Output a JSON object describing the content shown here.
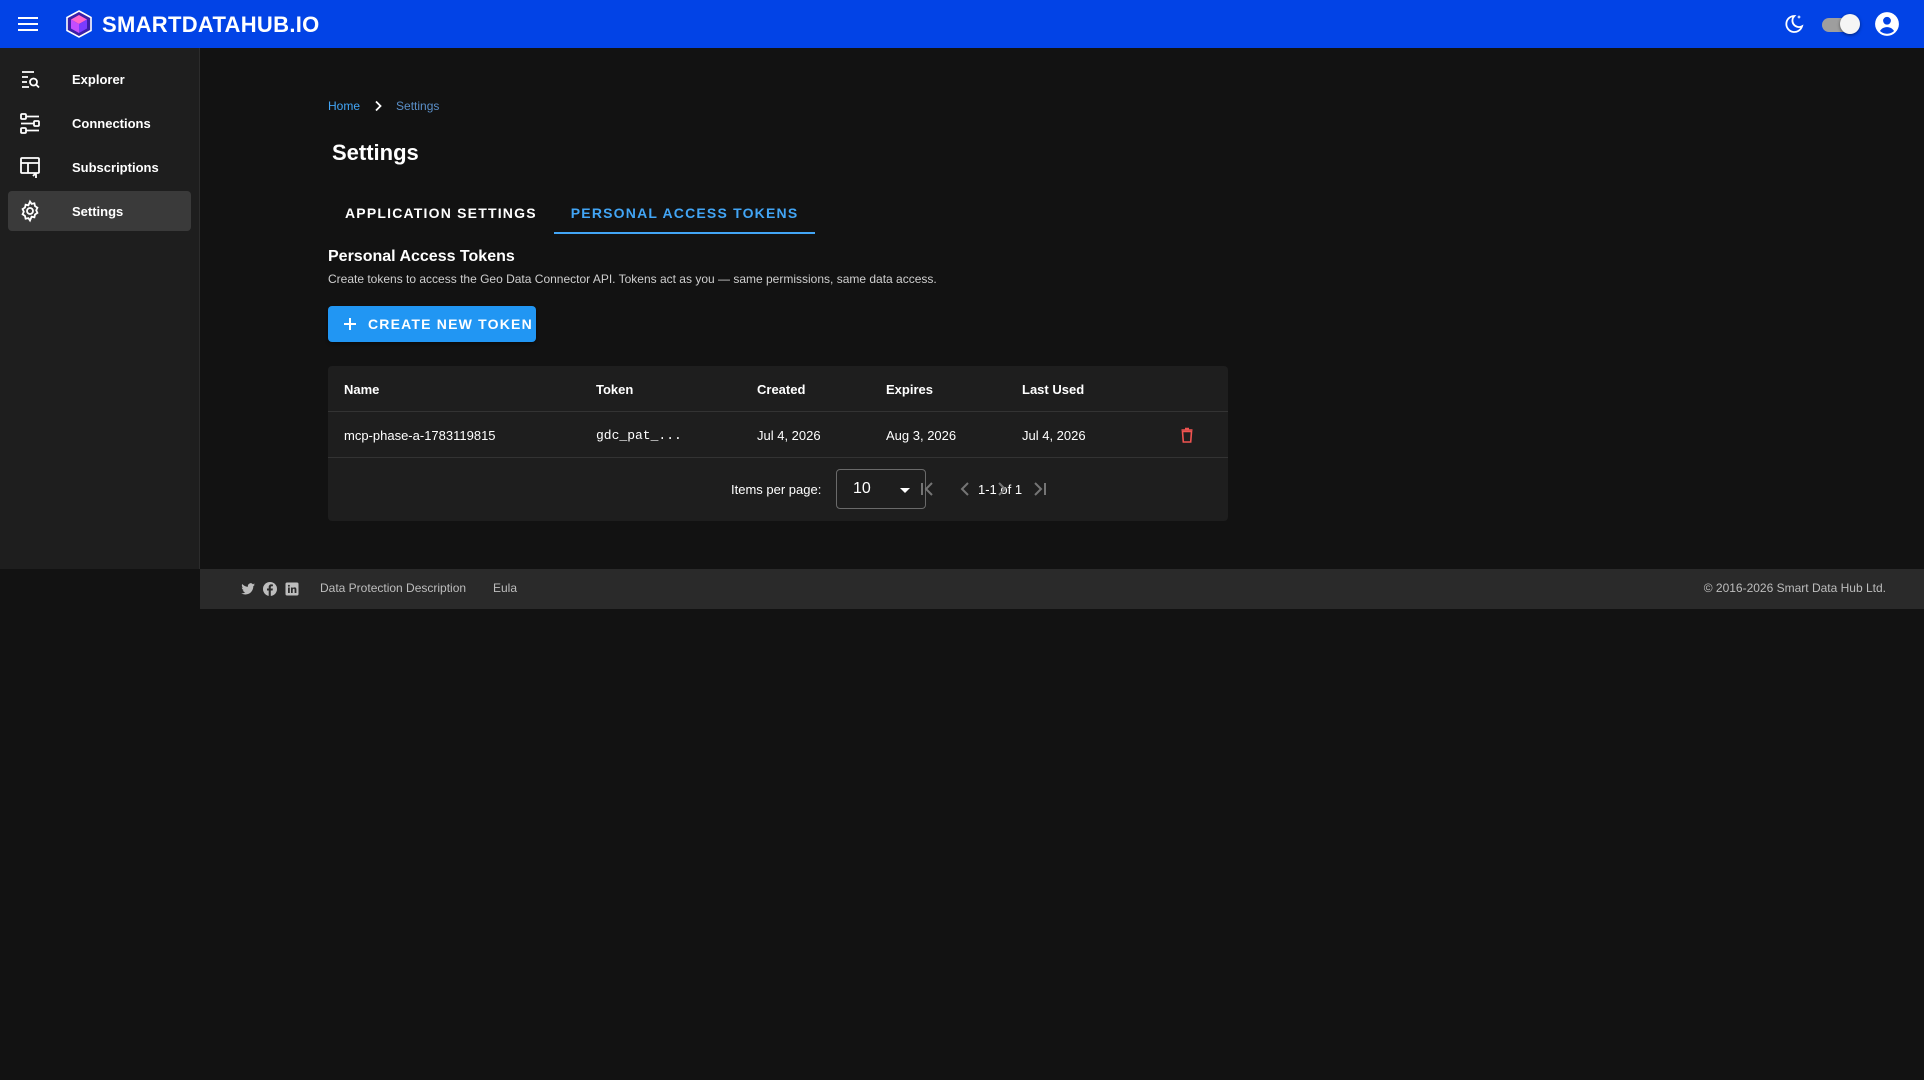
{
  "appbar": {
    "brand": "SMARTDATAHUB.IO",
    "icons": [
      "menu-icon",
      "cube-logo",
      "dark-mode-icon",
      "theme-toggle",
      "account-icon"
    ],
    "color": "#0243e6"
  },
  "sidebar": {
    "items": [
      {
        "label": "Explorer",
        "icon": "explorer-icon",
        "active": false
      },
      {
        "label": "Connections",
        "icon": "connections-icon",
        "active": false
      },
      {
        "label": "Subscriptions",
        "icon": "subscriptions-icon",
        "active": false
      },
      {
        "label": "Settings",
        "icon": "gear-icon",
        "active": true
      }
    ]
  },
  "breadcrumb": {
    "home": "Home",
    "current": "Settings"
  },
  "page": {
    "title": "Settings"
  },
  "tabs": [
    {
      "label": "APPLICATION SETTINGS",
      "active": false
    },
    {
      "label": "PERSONAL ACCESS TOKENS",
      "active": true
    }
  ],
  "tokens_section": {
    "title": "Personal Access Tokens",
    "description": "Create tokens to access the Geo Data Connector API. Tokens act as you — same permissions, same data access.",
    "create_button": "CREATE NEW TOKEN"
  },
  "table": {
    "headers": {
      "name": "Name",
      "token": "Token",
      "created": "Created",
      "expires": "Expires",
      "last_used": "Last Used"
    },
    "rows": [
      {
        "name": "mcp-phase-a-1783119815",
        "token": "gdc_pat_...",
        "created": "Jul 4, 2026",
        "expires": "Aug 3, 2026",
        "last_used": "Jul 4, 2026"
      }
    ],
    "pagination": {
      "items_per_page_label": "Items per page:",
      "items_per_page": "10",
      "range": "1-1 of 1"
    }
  },
  "footer": {
    "links": [
      "Data Protection Description",
      "Eula"
    ],
    "copyright": "© 2016-2026 Smart Data Hub Ltd."
  },
  "colors": {
    "accent": "#42a5f5",
    "button": "#2196f3",
    "danger": "#ef5350",
    "background": "#121212"
  }
}
